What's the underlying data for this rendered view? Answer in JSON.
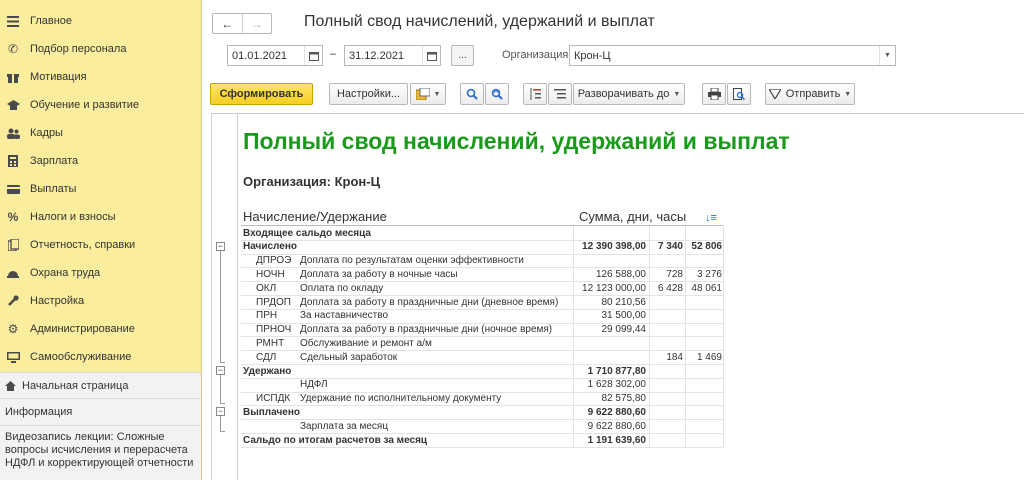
{
  "sidebar": {
    "items": [
      {
        "label": "Главное",
        "icon": "menu-icon"
      },
      {
        "label": "Подбор персонала",
        "icon": "phone-icon"
      },
      {
        "label": "Мотивация",
        "icon": "gift-icon"
      },
      {
        "label": "Обучение и развитие",
        "icon": "graduation-icon"
      },
      {
        "label": "Кадры",
        "icon": "people-icon"
      },
      {
        "label": "Зарплата",
        "icon": "calculator-icon"
      },
      {
        "label": "Выплаты",
        "icon": "card-icon"
      },
      {
        "label": "Налоги и взносы",
        "icon": "percent-icon"
      },
      {
        "label": "Отчетность, справки",
        "icon": "report-icon"
      },
      {
        "label": "Охрана труда",
        "icon": "helmet-icon"
      },
      {
        "label": "Настройка",
        "icon": "wrench-icon"
      },
      {
        "label": "Администрирование",
        "icon": "gear-icon"
      },
      {
        "label": "Самообслуживание",
        "icon": "monitor-icon"
      }
    ],
    "home": "Начальная страница",
    "info": "Информация",
    "video": "Видеозапись лекции: Сложные вопросы исчисления и перерасчета НДФЛ и корректирующей отчетности"
  },
  "header": {
    "back": "←",
    "forward": "→",
    "title": "Полный свод начислений, удержаний и выплат"
  },
  "filters": {
    "date_from": "01.01.2021",
    "date_to": "31.12.2021",
    "dash": "–",
    "dots": "...",
    "org_label": "Организация:",
    "org_value": "Крон-Ц"
  },
  "toolbar": {
    "generate": "Сформировать",
    "settings": "Настройки...",
    "expand": "Разворачивать до",
    "send": "Отправить"
  },
  "report": {
    "title": "Полный свод начислений, удержаний и выплат",
    "org": "Организация: Крон-Ц",
    "col_name": "Начисление/Удержание",
    "col_sum": "Сумма, дни, часы",
    "rows": [
      {
        "code": "",
        "name": "Входящее сальдо месяца",
        "sum": "",
        "days": "",
        "hours": "",
        "bold": true
      },
      {
        "code": "",
        "name": "Начислено",
        "sum": "12 390 398,00",
        "days": "7 340",
        "hours": "52 806",
        "bold": true
      },
      {
        "code": "ДПРОЭ",
        "name": "Доплата по результатам оценки эффективности",
        "sum": "",
        "days": "",
        "hours": ""
      },
      {
        "code": "НОЧН",
        "name": "Доплата за работу в ночные часы",
        "sum": "126 588,00",
        "days": "728",
        "hours": "3 276"
      },
      {
        "code": "ОКЛ",
        "name": "Оплата по окладу",
        "sum": "12 123 000,00",
        "days": "6 428",
        "hours": "48 061"
      },
      {
        "code": "ПРДОП",
        "name": "Доплата за работу в праздничные дни (дневное время)",
        "sum": "80 210,56",
        "days": "",
        "hours": ""
      },
      {
        "code": "ПРН",
        "name": "За наставничество",
        "sum": "31 500,00",
        "days": "",
        "hours": ""
      },
      {
        "code": "ПРНОЧ",
        "name": "Доплата за работу в праздничные дни (ночное время)",
        "sum": "29 099,44",
        "days": "",
        "hours": ""
      },
      {
        "code": "РМНТ",
        "name": "Обслуживание и ремонт а/м",
        "sum": "",
        "days": "",
        "hours": ""
      },
      {
        "code": "СДЛ",
        "name": "Сдельный заработок",
        "sum": "",
        "days": "184",
        "hours": "1 469"
      },
      {
        "code": "",
        "name": "Удержано",
        "sum": "1 710 877,80",
        "days": "",
        "hours": "",
        "bold": true
      },
      {
        "code": "",
        "name": "НДФЛ",
        "sum": "1 628 302,00",
        "days": "",
        "hours": "",
        "indent": true
      },
      {
        "code": "ИСПДК",
        "name": "Удержание по исполнительному документу",
        "sum": "82 575,80",
        "days": "",
        "hours": ""
      },
      {
        "code": "",
        "name": "Выплачено",
        "sum": "9 622 880,60",
        "days": "",
        "hours": "",
        "bold": true
      },
      {
        "code": "",
        "name": "Зарплата за месяц",
        "sum": "9 622 880,60",
        "days": "",
        "hours": "",
        "indent": true
      },
      {
        "code": "",
        "name": "Сальдо по итогам расчетов за месяц",
        "sum": "1 191 639,60",
        "days": "",
        "hours": "",
        "bold": true
      }
    ]
  },
  "colors": {
    "sidebar_bg": "#fbed9e",
    "title_green": "#1a9a1a",
    "primary_btn": "#f5cf1f"
  }
}
